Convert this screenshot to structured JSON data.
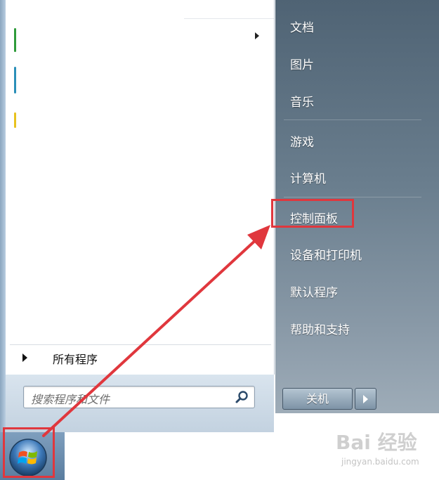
{
  "colors": {
    "highlight": "#e0373d",
    "right_panel": "#5f7484",
    "accent_green": "#2e9b3a",
    "accent_teal": "#2a8fb8",
    "accent_yellow": "#e8c21e"
  },
  "left_panel": {
    "all_programs_label": "所有程序"
  },
  "search": {
    "placeholder": "搜索程序和文件",
    "icon": "search-icon"
  },
  "right_panel": {
    "items": [
      {
        "label": "文档"
      },
      {
        "label": "图片"
      },
      {
        "label": "音乐"
      },
      {
        "label": "游戏"
      },
      {
        "label": "计算机"
      },
      {
        "label": "控制面板",
        "highlighted": true
      },
      {
        "label": "设备和打印机"
      },
      {
        "label": "默认程序"
      },
      {
        "label": "帮助和支持"
      }
    ],
    "shutdown_label": "关机"
  },
  "taskbar": {
    "start_icon": "windows-start-orb-icon"
  },
  "watermark": {
    "logo": "Bai 经验",
    "url": "jingyan.baidu.com"
  }
}
